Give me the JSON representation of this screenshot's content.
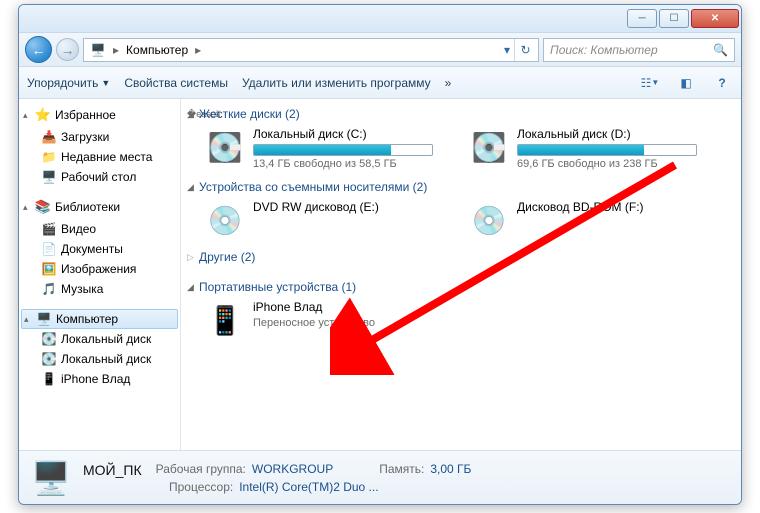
{
  "breadcrumb": {
    "location": "Компьютер"
  },
  "search": {
    "placeholder": "Поиск: Компьютер"
  },
  "toolbar": {
    "organize": "Упорядочить",
    "props": "Свойства системы",
    "uninstall": "Удалить или изменить программу",
    "overflow": "»"
  },
  "sidebar": {
    "favorites": {
      "label": "Избранное",
      "items": [
        "Загрузки",
        "Недавние места",
        "Рабочий стол"
      ]
    },
    "libraries": {
      "label": "Библиотеки",
      "items": [
        "Видео",
        "Документы",
        "Изображения",
        "Музыка"
      ]
    },
    "computer": {
      "label": "Компьютер",
      "items": [
        "Локальный диск",
        "Локальный диск",
        "iPhone Влад"
      ]
    }
  },
  "categories": {
    "hdd": {
      "label": "Жесткие диски (2)"
    },
    "removable": {
      "label": "Устройства со съемными носителями (2)"
    },
    "other": {
      "label": "Другие (2)"
    },
    "portable": {
      "label": "Портативные устройства (1)"
    }
  },
  "drives": {
    "c": {
      "name": "Локальный диск (C:)",
      "free": "13,4 ГБ свободно из 58,5 ГБ",
      "fill_pct": 77
    },
    "d": {
      "name": "Локальный диск (D:)",
      "free": "69,6 ГБ свободно из 238 ГБ",
      "fill_pct": 71
    },
    "dvd": {
      "name": "DVD RW дисковод (E:)"
    },
    "bd": {
      "name": "Дисковод BD-ROM (F:)"
    }
  },
  "portable": {
    "iphone": {
      "name": "iPhone Влад",
      "type": "Переносное устройство"
    }
  },
  "details": {
    "name": "МОЙ_ПК",
    "workgroup_lbl": "Рабочая группа:",
    "workgroup": "WORKGROUP",
    "memory_lbl": "Память:",
    "memory": "3,00 ГБ",
    "cpu_lbl": "Процессор:",
    "cpu": "Intel(R) Core(TM)2 Duo ..."
  }
}
